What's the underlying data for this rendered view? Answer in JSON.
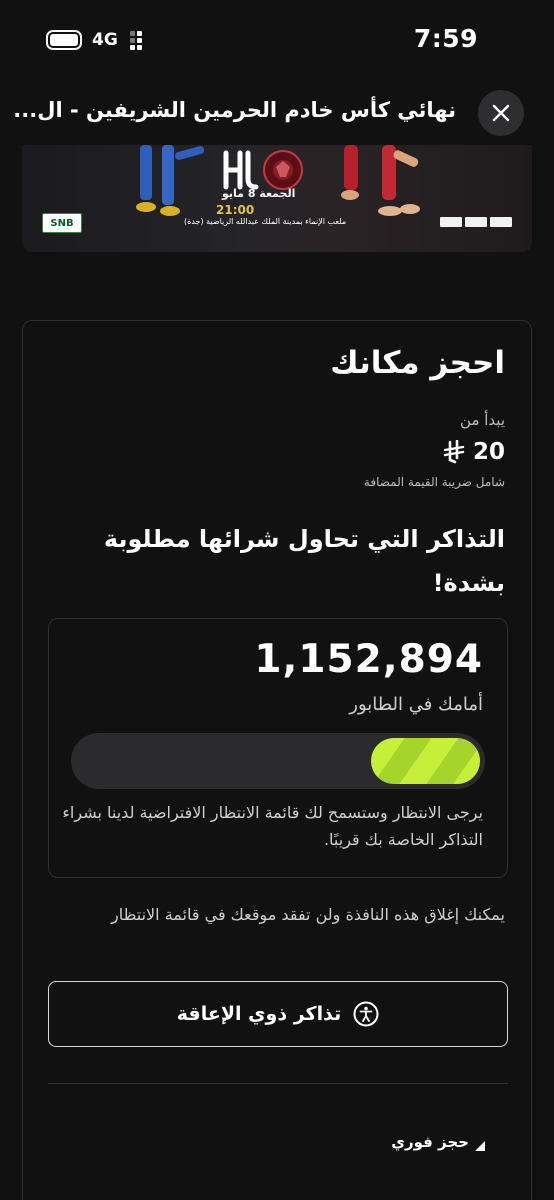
{
  "status_bar": {
    "time": "7:59",
    "network": "4G",
    "icons": [
      "battery-icon",
      "signal-icon"
    ]
  },
  "header": {
    "title": "نهائي كأس خادم الحرمين الشريفين - ال...",
    "close_icon": "close-icon"
  },
  "banner": {
    "date": "الجمعة 8 مايو",
    "time": "21:00",
    "venue": "ملعب الإنماء بمدينة الملك عبدالله الرياضية (جدة)",
    "sponsor": "SNB"
  },
  "booking": {
    "title": "احجز مكانك",
    "starts_from": "يبدأ من",
    "price": "20",
    "currency_icon": "saudi-riyal-icon",
    "vat_note": "شامل ضريبة القيمة المضافة",
    "demand_message": "التذاكر التي تحاول شرائها مطلوبة بشدة!"
  },
  "queue": {
    "count": "1,152,894",
    "label": "أمامك في الطابور",
    "progress": 0.27,
    "note": "يرجى الانتظار وستسمح لك قائمة الانتظار الافتراضية لدينا بشراء التذاكر الخاصة بك قريبًا."
  },
  "close_note": "يمكنك إغلاق هذه النافذة ولن تفقد موقعك في قائمة الانتظار",
  "accessibility_button": {
    "label": "تذاكر ذوي الإعاقة",
    "icon": "accessibility-icon"
  },
  "instant_booking": {
    "label": "حجز فوري"
  },
  "colors": {
    "background": "#111112",
    "progress_accent": "#c6ef3a",
    "card_border": "#2f2f33",
    "banner_time": "#e3c34a"
  }
}
